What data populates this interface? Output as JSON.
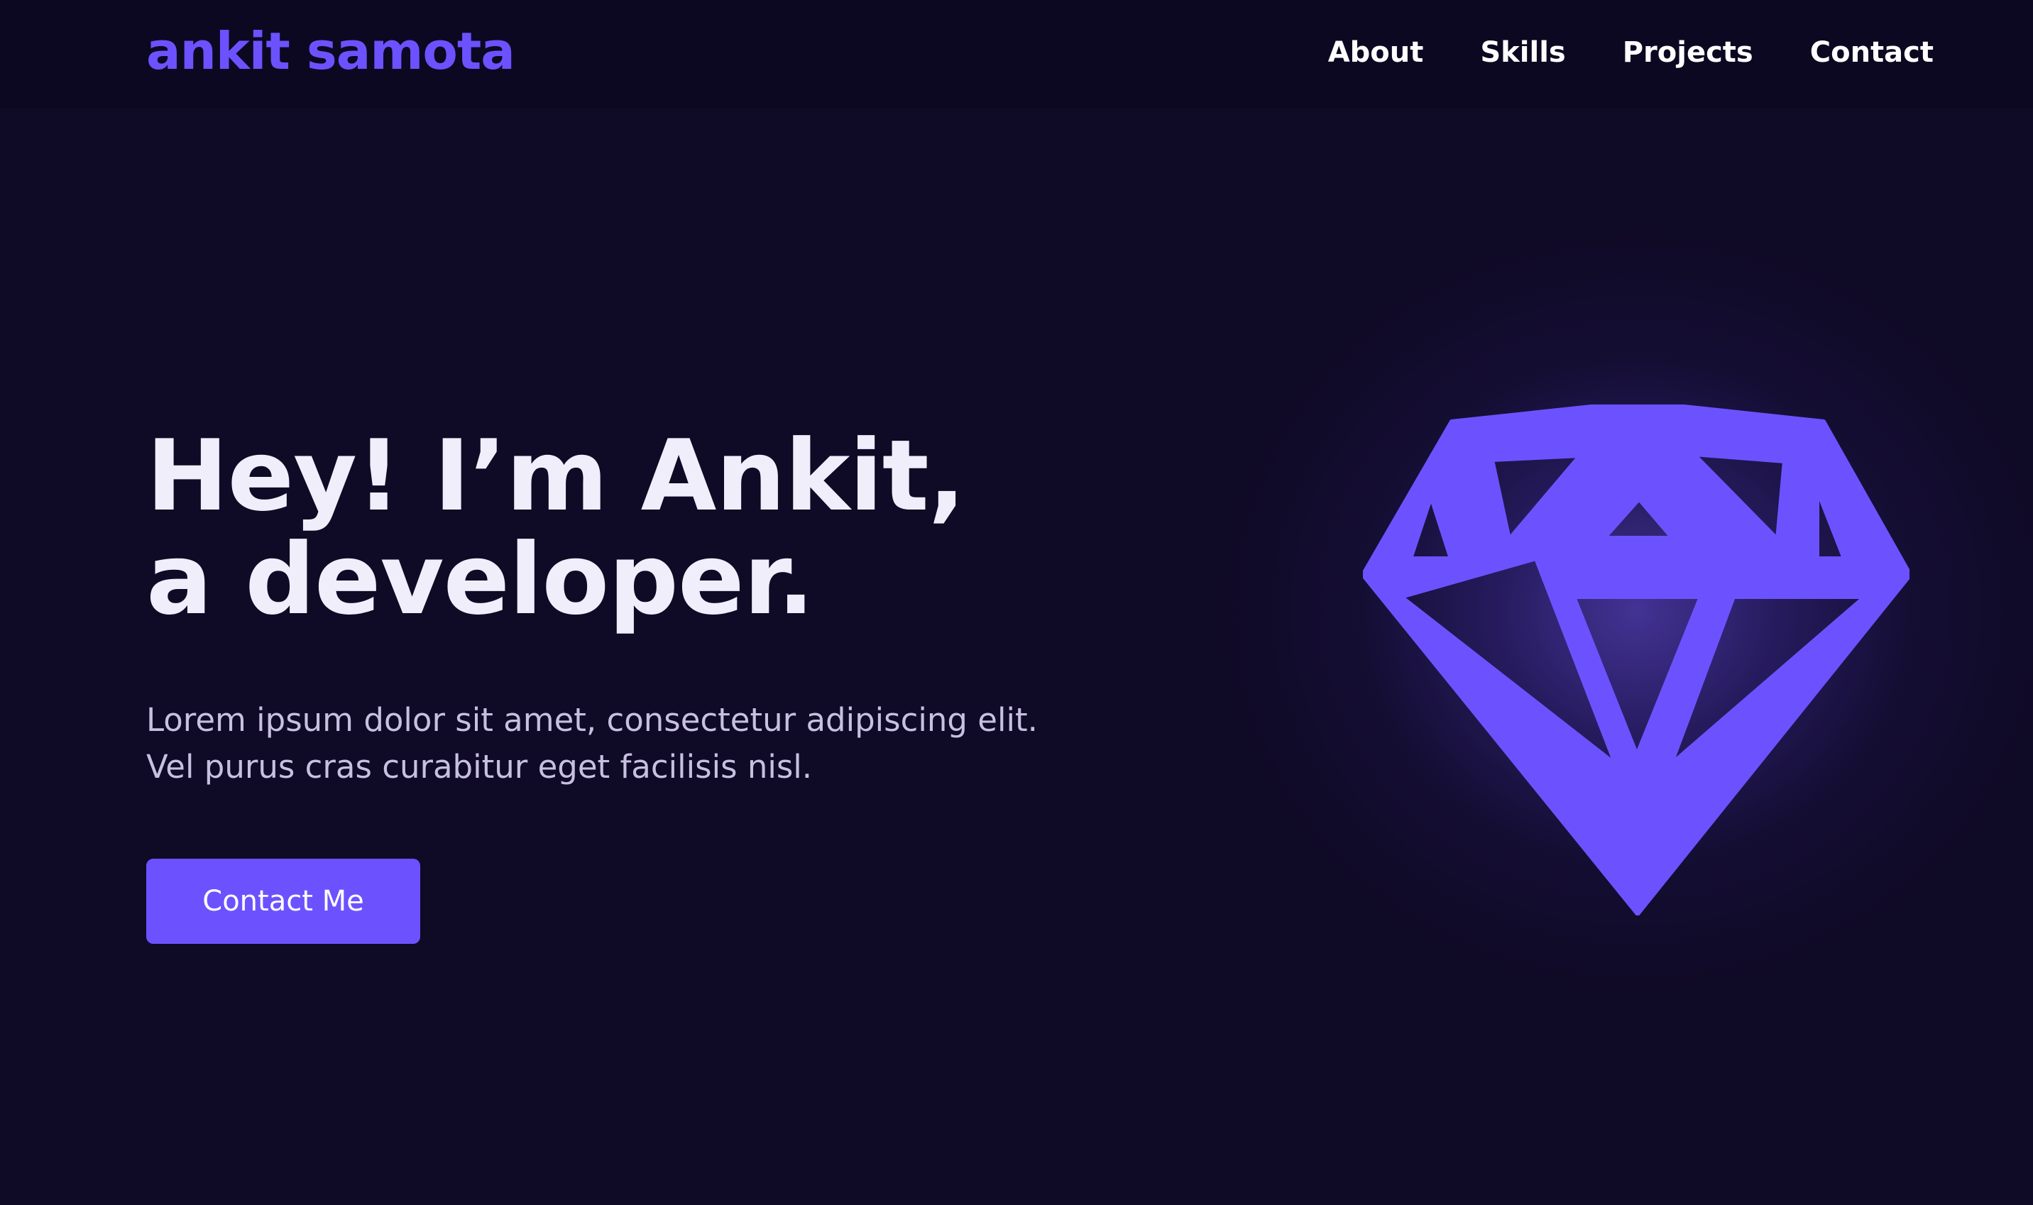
{
  "header": {
    "brand": "ankit samota",
    "nav": [
      "About",
      "Skills",
      "Projects",
      "Contact"
    ]
  },
  "hero": {
    "title_line1": "Hey! I’m Ankit,",
    "title_line2": "a developer.",
    "text_line1": "Lorem ipsum dolor sit amet, consectetur adipiscing elit.",
    "text_line2": "Vel purus cras curabitur eget facilisis nisl.",
    "cta_label": "Contact Me",
    "illustration_icon": "diamond-icon"
  },
  "colors": {
    "background": "#0f0a25",
    "accent": "#6c52ff",
    "heading": "#f1eefb",
    "body_text": "#c7c0e0"
  }
}
